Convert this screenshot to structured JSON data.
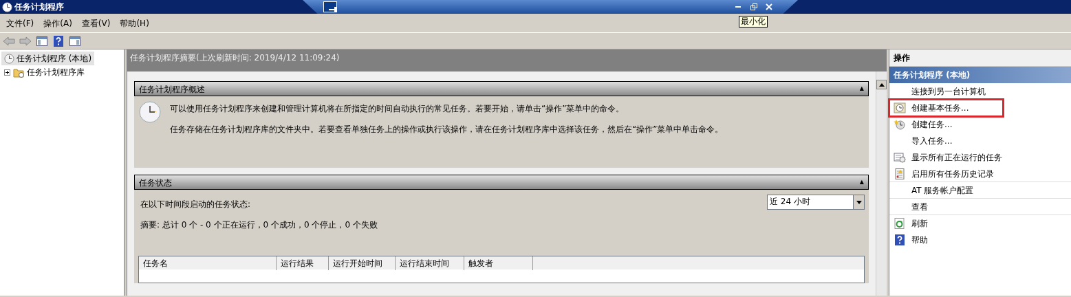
{
  "window": {
    "title": "任务计划程序"
  },
  "remote_bar": {
    "tooltip": "最小化"
  },
  "menu": [
    "文件(F)",
    "操作(A)",
    "查看(V)",
    "帮助(H)"
  ],
  "tree": [
    {
      "label": "任务计划程序 (本地)",
      "selected": true,
      "children": [
        {
          "label": "任务计划程序库",
          "selected": false,
          "expanded": false
        }
      ]
    }
  ],
  "center": {
    "header": "任务计划程序摘要(上次刷新时间: 2019/4/12 11:09:24)",
    "overview": {
      "title": "任务计划程序概述",
      "collapse": "▲",
      "paragraphs": [
        "可以使用任务计划程序来创建和管理计算机将在所指定的时间自动执行的常见任务。若要开始，请单击“操作”菜单中的命令。",
        "任务存储在任务计划程序库的文件夹中。若要查看单独任务上的操作或执行该操作，请在任务计划程序库中选择该任务，然后在“操作”菜单中单击命令。"
      ]
    },
    "status": {
      "title": "任务状态",
      "collapse": "▲",
      "label": "在以下时间段启动的任务状态:",
      "range": "近 24 小时",
      "summary": "摘要: 总计 0 个 - 0 个正在运行，0 个成功，0 个停止，0 个失败",
      "columns": [
        "任务名",
        "运行结果",
        "运行开始时间",
        "运行结束时间",
        "触发者"
      ]
    }
  },
  "actions": {
    "title": "操作",
    "group": "任务计划程序 (本地)",
    "items": [
      {
        "label": "连接到另一台计算机",
        "kind": "plain",
        "highlighted": false,
        "divider": false
      },
      {
        "label": "创建基本任务...",
        "kind": "basic-task",
        "highlighted": true,
        "divider": false
      },
      {
        "label": "创建任务...",
        "kind": "new-task",
        "highlighted": false,
        "divider": false
      },
      {
        "label": "导入任务...",
        "kind": "plain",
        "highlighted": false,
        "divider": false
      },
      {
        "label": "显示所有正在运行的任务",
        "kind": "running",
        "highlighted": false,
        "divider": false
      },
      {
        "label": "启用所有任务历史记录",
        "kind": "history",
        "highlighted": false,
        "divider": true
      },
      {
        "label": "AT 服务帐户配置",
        "kind": "plain",
        "highlighted": false,
        "divider": true
      },
      {
        "label": "查看",
        "kind": "plain",
        "highlighted": false,
        "divider": true
      },
      {
        "label": "刷新",
        "kind": "refresh",
        "highlighted": false,
        "divider": false
      },
      {
        "label": "帮助",
        "kind": "help",
        "highlighted": false,
        "divider": false
      }
    ]
  }
}
